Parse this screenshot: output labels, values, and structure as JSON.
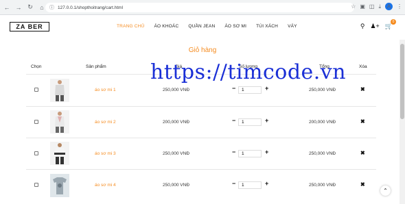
{
  "browser": {
    "url": "127.0.0.1/shopthoitrang/cart.html",
    "profile_initial": "A"
  },
  "header": {
    "logo": "ZA BER",
    "menu": [
      "TRANG CHỦ",
      "ÁO KHOÁC",
      "QUẦN JEAN",
      "ÁO SƠ MI",
      "TÚI XÁCH",
      "VÁY"
    ],
    "cart_count": "0"
  },
  "cart": {
    "title": "Giỏ hàng",
    "columns": {
      "select": "Chọn",
      "product": "Sản phẩm",
      "price": "Giá",
      "quantity": "Số lượng",
      "total": "Tổng",
      "delete": "Xóa"
    },
    "items": [
      {
        "name": "áo sơ mi 1",
        "price": "250,000 VNĐ",
        "qty": "1",
        "total": "250,000 VNĐ",
        "thumb": "shirt-man-1"
      },
      {
        "name": "áo sơ mi 2",
        "price": "200,000 VNĐ",
        "qty": "1",
        "total": "200,000 VNĐ",
        "thumb": "shirt-man-2"
      },
      {
        "name": "áo sơ mi 3",
        "price": "250,000 VNĐ",
        "qty": "1",
        "total": "250,000 VNĐ",
        "thumb": "shirt-man-3"
      },
      {
        "name": "áo sơ mi 4",
        "price": "250,000 VNĐ",
        "qty": "1",
        "total": "250,000 VNĐ",
        "thumb": "tshirt-grey"
      }
    ]
  },
  "watermark": "https://timcode.vn",
  "colors": {
    "accent": "#f58b1f",
    "watermark": "#1a2fd6"
  }
}
